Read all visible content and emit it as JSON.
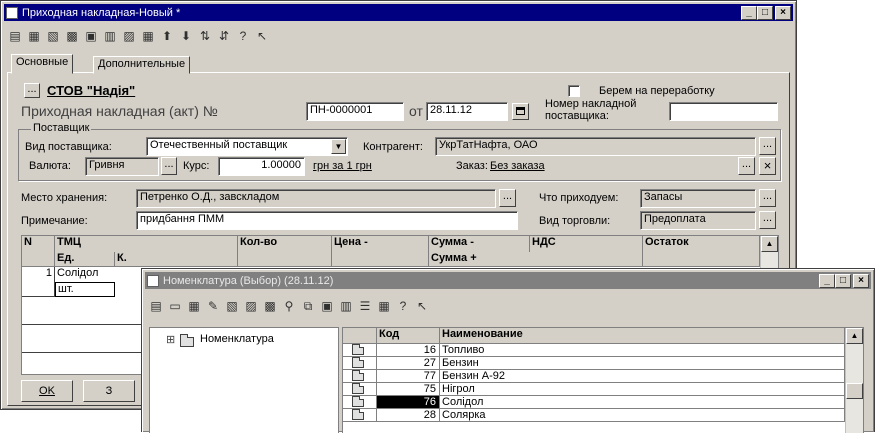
{
  "main_window": {
    "title": "Приходная накладная-Новый *",
    "tabs": [
      {
        "label": "Основные"
      },
      {
        "label": "Дополнительные"
      }
    ],
    "org_name": "СТОВ \"Надія\"",
    "rework_label": "Берем на переработку",
    "doc_label": "Приходная накладная (акт) №",
    "doc_number": "ПН-0000001",
    "date_label": "от",
    "date_value": "28.11.12",
    "supplier_invoice_label_1": "Номер накладной",
    "supplier_invoice_label_2": "поставщика:",
    "supplier_group_label": "Поставщик",
    "supplier_type_label": "Вид поставщика:",
    "supplier_type_value": "Отечественный поставщик",
    "contractor_label": "Контрагент:",
    "contractor_value": "УкрТатНафта, ОАО",
    "currency_label": "Валюта:",
    "currency_value": "Гривня",
    "rate_label": "Курс:",
    "rate_value": "1.00000",
    "rate_unit": "грн за 1 грн",
    "order_label": "Заказ:",
    "order_value": "Без заказа",
    "storage_label": "Место хранения:",
    "storage_value": "Петренко О.Д., завскладом",
    "incoming_label": "Что приходуем:",
    "incoming_value": "Запасы",
    "note_label": "Примечание:",
    "note_value": "придбання ПММ",
    "trade_label": "Вид торговли:",
    "trade_value": "Предоплата",
    "grid_headers": {
      "n": "N",
      "tmc": "ТМЦ",
      "unit": "Ед.",
      "k": "К.",
      "qty": "Кол-во",
      "price": "Цена -",
      "sum_minus": "Сумма -",
      "sum_plus": "Сумма +",
      "vat": "НДС",
      "rest": "Остаток"
    },
    "grid_row": {
      "n": "1",
      "name": "Солідол",
      "unit": "шт."
    },
    "ok_label": "OK",
    "second_button_label": "З"
  },
  "nomen_window": {
    "title": "Номенклатура (Выбор) (28.11.12)",
    "tree_root": "Номенклатура",
    "tree_expander": "⊞",
    "headers": {
      "code": "Код",
      "name": "Наименование"
    },
    "rows": [
      {
        "code": "16",
        "name": "Топливо"
      },
      {
        "code": "27",
        "name": "Бензин"
      },
      {
        "code": "77",
        "name": "Бензин А-92"
      },
      {
        "code": "75",
        "name": "Нігрол"
      },
      {
        "code": "76",
        "name": "Солідол"
      },
      {
        "code": "28",
        "name": "Солярка"
      }
    ],
    "selected_row": 4
  },
  "colors": {
    "title_active": "#000080",
    "title_inactive": "#808080",
    "face": "#d4d0c8",
    "selection": "#000000"
  }
}
